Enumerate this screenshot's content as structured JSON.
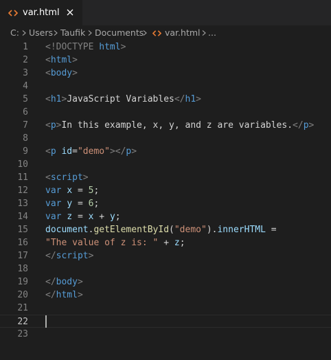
{
  "tab": {
    "label": "var.html",
    "icon": "html-file-icon"
  },
  "breadcrumb": {
    "items": [
      "C:",
      "Users",
      "Taufik",
      "Documents",
      "var.html",
      "..."
    ]
  },
  "editor": {
    "current_line": 22,
    "line_numbers": [
      "1",
      "2",
      "3",
      "4",
      "5",
      "6",
      "7",
      "8",
      "9",
      "10",
      "11",
      "12",
      "13",
      "14",
      "15",
      "16",
      "17",
      "18",
      "19",
      "20",
      "21",
      "22",
      "23"
    ],
    "lines": [
      [
        {
          "t": "<!DOCTYPE ",
          "c": "t-punct"
        },
        {
          "t": "html",
          "c": "t-tag"
        },
        {
          "t": ">",
          "c": "t-punct"
        }
      ],
      [
        {
          "t": "<",
          "c": "t-punct"
        },
        {
          "t": "html",
          "c": "t-tag"
        },
        {
          "t": ">",
          "c": "t-punct"
        }
      ],
      [
        {
          "t": "<",
          "c": "t-punct"
        },
        {
          "t": "body",
          "c": "t-tag"
        },
        {
          "t": ">",
          "c": "t-punct"
        }
      ],
      [],
      [
        {
          "t": "<",
          "c": "t-punct"
        },
        {
          "t": "h1",
          "c": "t-tag"
        },
        {
          "t": ">",
          "c": "t-punct"
        },
        {
          "t": "JavaScript Variables",
          "c": "t-text"
        },
        {
          "t": "</",
          "c": "t-punct"
        },
        {
          "t": "h1",
          "c": "t-tag"
        },
        {
          "t": ">",
          "c": "t-punct"
        }
      ],
      [],
      [
        {
          "t": "<",
          "c": "t-punct"
        },
        {
          "t": "p",
          "c": "t-tag"
        },
        {
          "t": ">",
          "c": "t-punct"
        },
        {
          "t": "In this example, x, y, and z are variables.",
          "c": "t-text"
        },
        {
          "t": "</",
          "c": "t-punct"
        },
        {
          "t": "p",
          "c": "t-tag"
        },
        {
          "t": ">",
          "c": "t-punct"
        }
      ],
      [],
      [
        {
          "t": "<",
          "c": "t-punct"
        },
        {
          "t": "p",
          "c": "t-tag"
        },
        {
          "t": " ",
          "c": "t-text"
        },
        {
          "t": "id",
          "c": "t-attr"
        },
        {
          "t": "=",
          "c": "t-text"
        },
        {
          "t": "\"demo\"",
          "c": "t-str"
        },
        {
          "t": "></",
          "c": "t-punct"
        },
        {
          "t": "p",
          "c": "t-tag"
        },
        {
          "t": ">",
          "c": "t-punct"
        }
      ],
      [],
      [
        {
          "t": "<",
          "c": "t-punct"
        },
        {
          "t": "script",
          "c": "t-tag"
        },
        {
          "t": ">",
          "c": "t-punct"
        }
      ],
      [
        {
          "t": "var",
          "c": "t-kw"
        },
        {
          "t": " ",
          "c": "t-text"
        },
        {
          "t": "x",
          "c": "t-var"
        },
        {
          "t": " = ",
          "c": "t-text"
        },
        {
          "t": "5",
          "c": "t-num"
        },
        {
          "t": ";",
          "c": "t-text"
        }
      ],
      [
        {
          "t": "var",
          "c": "t-kw"
        },
        {
          "t": " ",
          "c": "t-text"
        },
        {
          "t": "y",
          "c": "t-var"
        },
        {
          "t": " = ",
          "c": "t-text"
        },
        {
          "t": "6",
          "c": "t-num"
        },
        {
          "t": ";",
          "c": "t-text"
        }
      ],
      [
        {
          "t": "var",
          "c": "t-kw"
        },
        {
          "t": " ",
          "c": "t-text"
        },
        {
          "t": "z",
          "c": "t-var"
        },
        {
          "t": " = ",
          "c": "t-text"
        },
        {
          "t": "x",
          "c": "t-var"
        },
        {
          "t": " + ",
          "c": "t-text"
        },
        {
          "t": "y",
          "c": "t-var"
        },
        {
          "t": ";",
          "c": "t-text"
        }
      ],
      [
        {
          "t": "document",
          "c": "t-var"
        },
        {
          "t": ".",
          "c": "t-text"
        },
        {
          "t": "getElementById",
          "c": "t-fn"
        },
        {
          "t": "(",
          "c": "t-text"
        },
        {
          "t": "\"demo\"",
          "c": "t-str"
        },
        {
          "t": ").",
          "c": "t-text"
        },
        {
          "t": "innerHTML",
          "c": "t-var"
        },
        {
          "t": " =",
          "c": "t-text"
        }
      ],
      [
        {
          "t": "\"The value of z is: \"",
          "c": "t-str"
        },
        {
          "t": " + ",
          "c": "t-text"
        },
        {
          "t": "z",
          "c": "t-var"
        },
        {
          "t": ";",
          "c": "t-text"
        }
      ],
      [
        {
          "t": "</",
          "c": "t-punct"
        },
        {
          "t": "script",
          "c": "t-tag"
        },
        {
          "t": ">",
          "c": "t-punct"
        }
      ],
      [],
      [
        {
          "t": "</",
          "c": "t-punct"
        },
        {
          "t": "body",
          "c": "t-tag"
        },
        {
          "t": ">",
          "c": "t-punct"
        }
      ],
      [
        {
          "t": "</",
          "c": "t-punct"
        },
        {
          "t": "html",
          "c": "t-tag"
        },
        {
          "t": ">",
          "c": "t-punct"
        }
      ],
      [],
      [],
      []
    ]
  },
  "colors": {
    "editor_bg": "#1e1e1e",
    "tabbar_bg": "#252526",
    "tag": "#569cd6",
    "punct": "#808080",
    "attr": "#9cdcfe",
    "string": "#ce9178",
    "number": "#b5cea8",
    "function": "#dcdcaa",
    "text": "#d4d4d4",
    "line_number": "#858585",
    "html_icon": "#e37933"
  }
}
